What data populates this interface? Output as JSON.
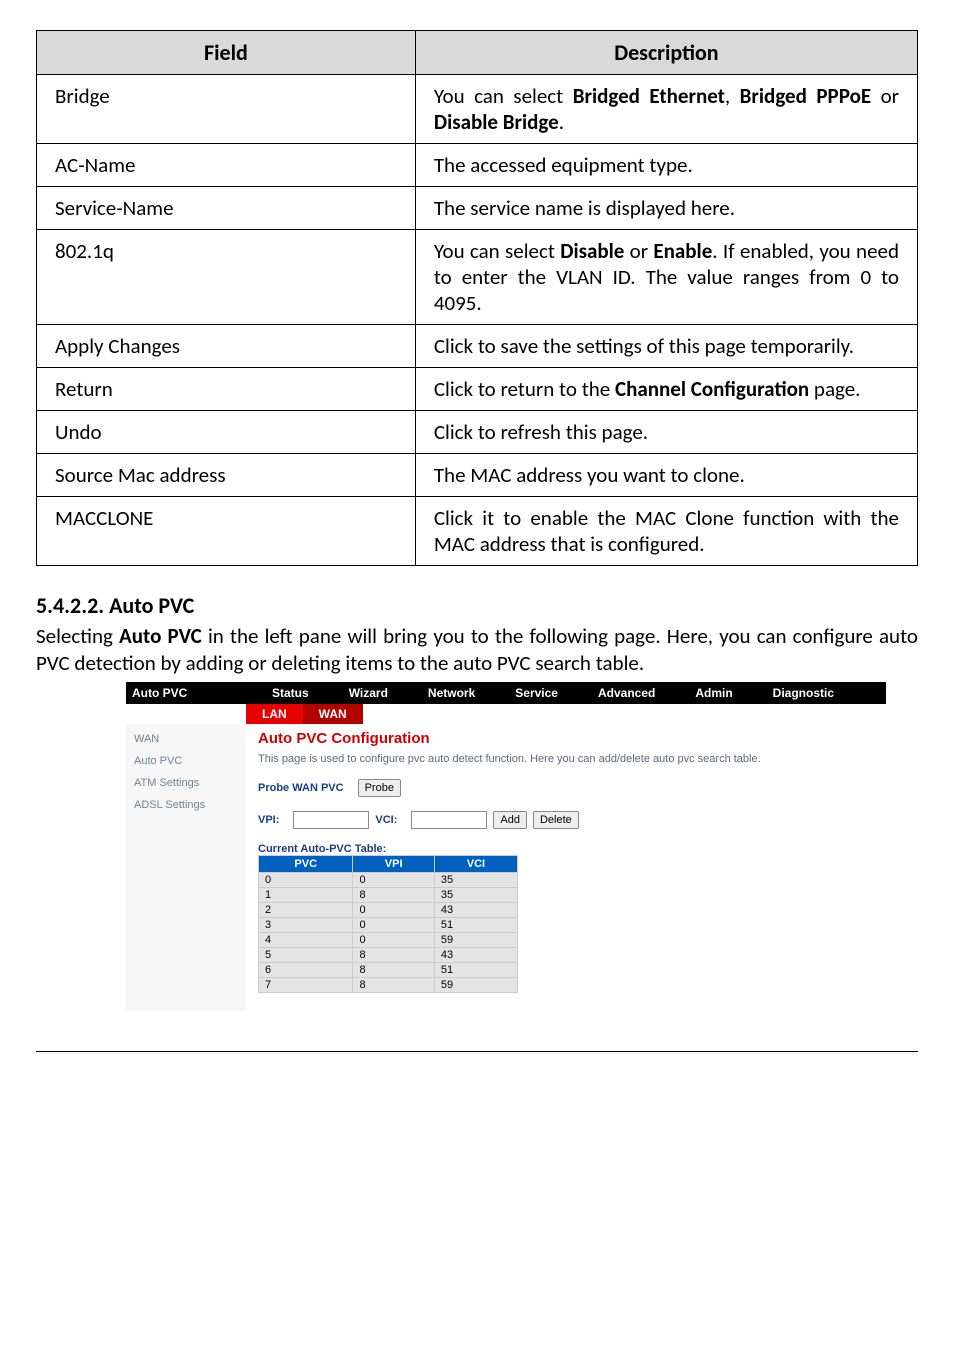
{
  "table": {
    "headers": {
      "field": "Field",
      "description": "Description"
    },
    "rows": [
      {
        "field": "Bridge",
        "description_html": "You can select <b>Bridged Ethernet</b>, <b>Bridged PPPoE</b> or <b>Disable Bridge</b>."
      },
      {
        "field": "AC-Name",
        "description_html": "The accessed equipment type."
      },
      {
        "field": "Service-Name",
        "description_html": "The service name is displayed here."
      },
      {
        "field": "802.1q",
        "description_html": "You can select <b>Disable</b> or <b>Enable</b>. If enabled, you need to enter the VLAN ID. The value ranges from 0 to 4095."
      },
      {
        "field": "Apply Changes",
        "description_html": "Click to save the settings of this page temporarily."
      },
      {
        "field": "Return",
        "description_html": "Click to return to the <b>Channel Configuration</b> page."
      },
      {
        "field": "Undo",
        "description_html": "Click to refresh this page."
      },
      {
        "field": "Source Mac address",
        "description_html": "The MAC address you want to clone."
      },
      {
        "field": "MACCLONE",
        "description_html": "Click it to enable the MAC Clone function with the MAC address that is configured."
      }
    ]
  },
  "section": {
    "heading": "5.4.2.2.   Auto PVC",
    "body": "Selecting <b>Auto PVC</b> in the left pane will bring you to the following page. Here, you can configure auto PVC detection by adding or deleting items to the auto PVC search table."
  },
  "shot": {
    "leftLabel": "Auto PVC",
    "tabs": [
      "Status",
      "Wizard",
      "Network",
      "Service",
      "Advanced",
      "Admin",
      "Diagnostic"
    ],
    "subTabs": {
      "lan": "LAN",
      "wan": "WAN"
    },
    "sidebar": [
      "WAN",
      "Auto PVC",
      "ATM Settings",
      "ADSL Settings"
    ],
    "cfg": {
      "title": "Auto PVC Configuration",
      "desc": "This page is used to configure pvc auto detect function. Here you can add/delete auto pvc search table.",
      "probeLabel": "Probe WAN PVC",
      "probeBtn": "Probe",
      "vpiLabel": "VPI:",
      "vciLabel": "VCI:",
      "addBtn": "Add",
      "delBtn": "Delete",
      "tableHeading": "Current Auto-PVC Table:",
      "headers": {
        "pvc": "PVC",
        "vpi": "VPI",
        "vci": "VCI"
      }
    },
    "chart_data": {
      "type": "table",
      "columns": [
        "PVC",
        "VPI",
        "VCI"
      ],
      "rows": [
        [
          0,
          0,
          35
        ],
        [
          1,
          8,
          35
        ],
        [
          2,
          0,
          43
        ],
        [
          3,
          0,
          51
        ],
        [
          4,
          0,
          59
        ],
        [
          5,
          8,
          43
        ],
        [
          6,
          8,
          51
        ],
        [
          7,
          8,
          59
        ]
      ]
    }
  }
}
